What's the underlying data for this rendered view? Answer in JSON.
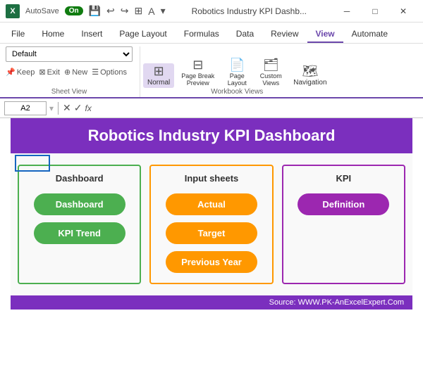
{
  "titleBar": {
    "appName": "Excel",
    "appIcon": "X",
    "autosave": "AutoSave",
    "autosaveState": "On",
    "title": "Robotics Industry KPI Dashb...",
    "undoIcon": "↩",
    "redoIcon": "↪",
    "gridIcon": "⊞",
    "fontColorIcon": "A",
    "moreIcon": "▾"
  },
  "ribbonTabs": {
    "tabs": [
      "File",
      "Home",
      "Insert",
      "Page Layout",
      "Formulas",
      "Data",
      "Review",
      "View",
      "Automate"
    ],
    "activeTab": "View"
  },
  "sheetView": {
    "groupLabel": "Sheet View",
    "dropdownValue": "Default",
    "keepLabel": "Keep",
    "exitLabel": "Exit",
    "newLabel": "New",
    "optionsLabel": "Options"
  },
  "workbookViews": {
    "groupLabel": "Workbook Views",
    "normalLabel": "Normal",
    "pageBreakLabel": "Page Break\nPreview",
    "pageLayoutLabel": "Page\nLayout",
    "customViewsLabel": "Custom\nViews",
    "navigationLabel": "Navigation"
  },
  "formulaBar": {
    "cellRef": "A2",
    "fxLabel": "fx"
  },
  "dashboard": {
    "title": "Robotics Industry KPI Dashboard",
    "sections": [
      {
        "title": "Dashboard",
        "borderColor": "green",
        "buttons": [
          "Dashboard",
          "KPI Trend"
        ]
      },
      {
        "title": "Input sheets",
        "borderColor": "orange",
        "buttons": [
          "Actual",
          "Target",
          "Previous Year"
        ]
      },
      {
        "title": "KPI",
        "borderColor": "purple",
        "buttons": [
          "Definition"
        ]
      }
    ],
    "footer": "Source: WWW.PK-AnExcelExpert.Com"
  }
}
